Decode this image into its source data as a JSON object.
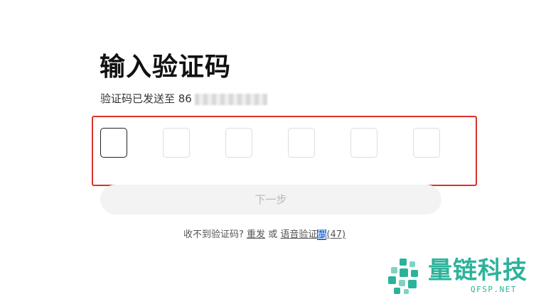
{
  "page": {
    "title": "输入验证码",
    "sent_text": "验证码已发送至 86"
  },
  "code_input": {
    "boxes": [
      "",
      "",
      "",
      "",
      "",
      ""
    ],
    "active_index": 0
  },
  "actions": {
    "next_label": "下一步"
  },
  "help": {
    "prompt": "收不到验证码?",
    "resend_label": "重发",
    "or_text": "或",
    "voice_label_part1": "语音验证",
    "voice_label_selected": "码",
    "countdown": "(47)"
  },
  "watermark": {
    "text": "量链科技",
    "subtext": "QFSP.NET",
    "color": "#2bb39a"
  },
  "colors": {
    "highlight_frame": "#d8332b",
    "selection": "#2f6fd6"
  }
}
